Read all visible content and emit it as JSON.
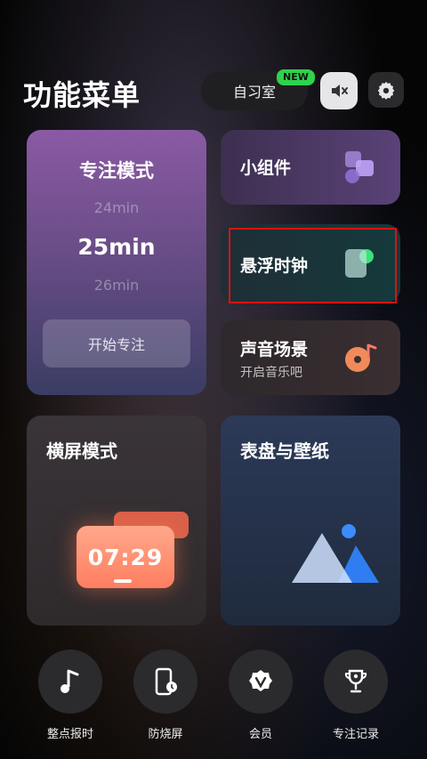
{
  "header": {
    "title": "功能菜单",
    "study_room_label": "自习室",
    "new_badge": "NEW",
    "mute_icon": "speaker-mute-icon",
    "settings_icon": "gear-icon"
  },
  "focus_card": {
    "title": "专注模式",
    "time_prev": "24min",
    "time_current": "25min",
    "time_next": "26min",
    "start_button": "开始专注"
  },
  "widgets_card": {
    "label": "小组件",
    "icon": "widgets-icon"
  },
  "floating_clock_card": {
    "label": "悬浮时钟",
    "icon": "floating-window-icon"
  },
  "sound_card": {
    "label": "声音场景",
    "sublabel": "开启音乐吧",
    "icon": "music-disc-icon"
  },
  "landscape_card": {
    "label": "横屏模式",
    "clock_text": "07:29"
  },
  "dial_card": {
    "label": "表盘与壁纸",
    "icon": "image-mountains-icon"
  },
  "bottom_nav": [
    {
      "label": "整点报时",
      "icon": "music-note-icon"
    },
    {
      "label": "防烧屏",
      "icon": "phone-clock-icon"
    },
    {
      "label": "会员",
      "icon": "vip-badge-icon"
    },
    {
      "label": "专注记录",
      "icon": "trophy-icon"
    }
  ],
  "colors": {
    "new_badge": "#2fd24c",
    "highlight_box": "#dd1111",
    "focus_card_top": "#8a5aa4",
    "clock_orange": "#ff7e60"
  }
}
